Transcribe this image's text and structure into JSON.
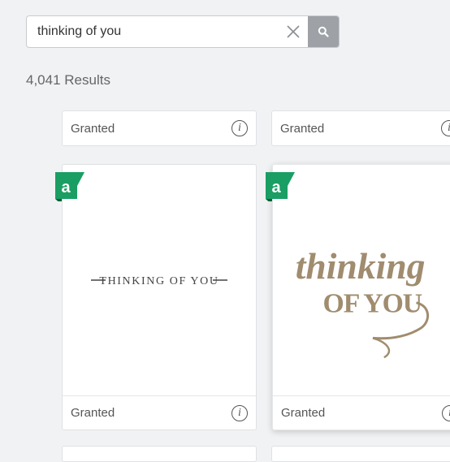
{
  "search": {
    "value": "thinking of you",
    "clear_label": "Clear search",
    "submit_label": "Search"
  },
  "results": {
    "count_text": "4,041 Results"
  },
  "cards": [
    {
      "status": "Granted"
    },
    {
      "status": "Granted"
    },
    {
      "status": "Granted",
      "badge": "a",
      "preview_text": "THINKING OF YOU"
    },
    {
      "status": "Granted",
      "badge": "a",
      "artwork": {
        "word1": "thinking",
        "word2": "OF YOU"
      }
    }
  ],
  "colors": {
    "badge_green": "#1a9e63",
    "badge_fold": "#0c5e36",
    "art_gold": "#a08c6e",
    "search_button": "#9ea1a6"
  }
}
